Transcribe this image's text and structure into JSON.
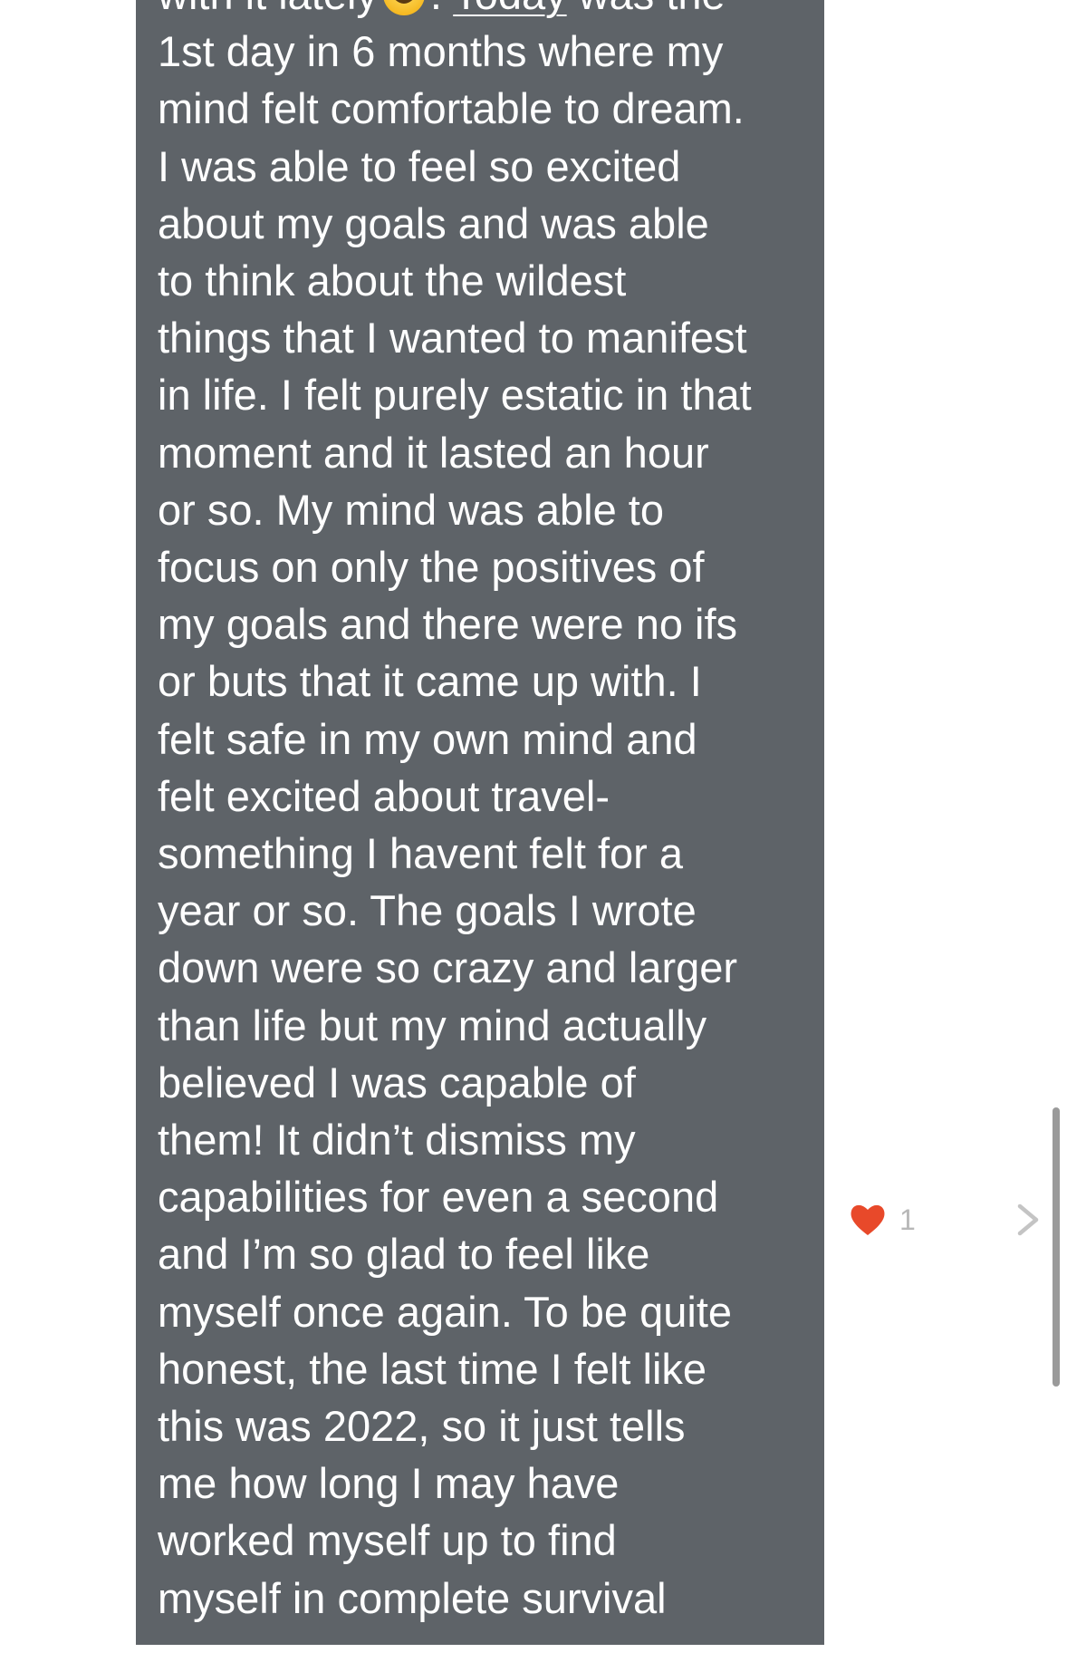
{
  "message": {
    "line_1_before": "with it lately",
    "line_1_emoji": "grinning-face-with-sweat-icon",
    "line_1_punct": ". ",
    "line_1_underlined": "Today",
    "line_1_after": " was the",
    "lines": [
      "1st day in 6 months where my",
      "mind felt comfortable to dream.",
      "I was able to feel so excited",
      "about my goals and was able",
      "to think about the wildest",
      "things that I wanted to manifest",
      "in life. I felt purely estatic in that",
      "moment and it lasted an hour",
      "or so. My mind was able to",
      "focus on only the positives of",
      "my goals and there were no ifs",
      "or buts that it came up with. I",
      "felt safe in my own mind and",
      "felt excited about travel-",
      "something I havent felt for a",
      "year or so. The goals I wrote",
      "down were so crazy and larger",
      "than life but my mind actually",
      "believed I was capable of",
      "them! It didn’t dismiss my",
      "capabilities for even a second",
      "and I’m so glad to feel like",
      "myself once again. To be quite",
      "honest, the last time I felt like",
      "this was 2022, so it just tells",
      "me how long I may have",
      "worked myself up to find",
      "myself in complete survival"
    ]
  },
  "reaction": {
    "icon": "heart-icon",
    "count": "1",
    "color": "#e8492a"
  },
  "navigation": {
    "icon": "chevron-right-icon"
  },
  "colors": {
    "bubble_background": "#5e6368",
    "text": "#ffffff",
    "page_background": "#ffffff"
  }
}
